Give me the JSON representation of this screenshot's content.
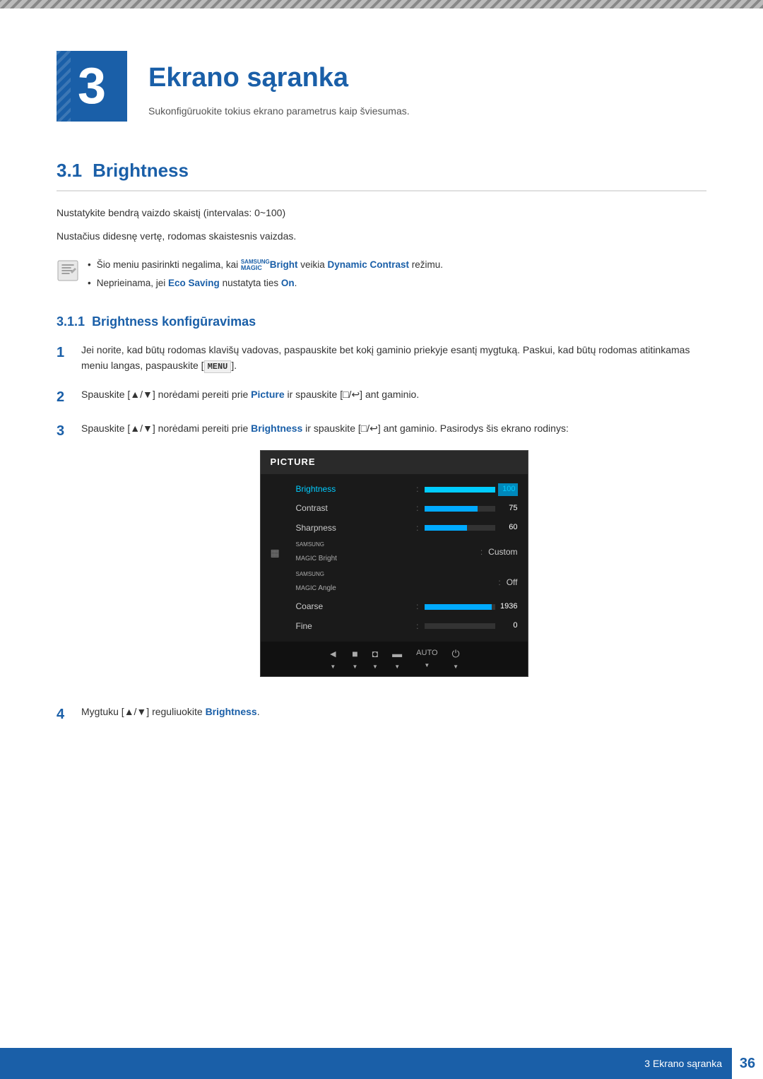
{
  "chapter": {
    "number": "3",
    "title": "Ekrano sąranka",
    "subtitle": "Sukonfigūruokite tokius ekrano parametrus kaip šviesumas.",
    "color": "#1a5fa8"
  },
  "section31": {
    "number": "3.1",
    "title": "Brightness",
    "body1": "Nustatykite bendrą vaizdo skaistį (intervalas: 0~100)",
    "body2": "Nustačius didesnę vertę, rodomas skaistesnis vaizdas.",
    "note1": "Šio meniu pasirinkti negalima, kai ",
    "note1_magic": "SAMSUNG",
    "note1_magic2": "MAGIC",
    "note1_bright": "Bright",
    "note1_mid": " veikia ",
    "note1_dynamic": "Dynamic Contrast",
    "note1_end": " režimu.",
    "note2_start": "Neprieinama, jei ",
    "note2_eco": "Eco Saving",
    "note2_end": " nustatyta ties ",
    "note2_on": "On",
    "note2_final": "."
  },
  "section311": {
    "number": "3.1.1",
    "title": "Brightness konfigūravimas",
    "step1": "Jei norite, kad būtų rodomas klavišų vadovas, paspauskite bet kokį gaminio priekyje esantį mygtuką. Paskui, kad būtų rodomas atitinkamas meniu langas, paspauskite [",
    "step1_key": "MENU",
    "step1_end": "].",
    "step2_start": "Spauskite [▲/▼] norėdami pereiti prie ",
    "step2_bold": "Picture",
    "step2_mid": " ir spauskite [□/↩] ant gaminio.",
    "step3_start": "Spauskite [▲/▼] norėdami pereiti prie ",
    "step3_bold": "Brightness",
    "step3_mid": " ir spauskite [□/↩] ant gaminio. Pasirodys šis ekrano rodinys:",
    "step4": "Mygtuku [▲/▼] reguliuokite ",
    "step4_bold": "Brightness",
    "step4_end": "."
  },
  "menu": {
    "header": "PICTURE",
    "rows": [
      {
        "label": "Brightness",
        "type": "bar",
        "fillPercent": 100,
        "value": "100",
        "active": true
      },
      {
        "label": "Contrast",
        "type": "bar",
        "fillPercent": 75,
        "value": "75",
        "active": false
      },
      {
        "label": "Sharpness",
        "type": "bar",
        "fillPercent": 60,
        "value": "60",
        "active": false
      },
      {
        "label": "SAMSUNG MAGIC Bright",
        "type": "text",
        "value": "Custom",
        "active": false
      },
      {
        "label": "SAMSUNG MAGIC Angle",
        "type": "text",
        "value": "Off",
        "active": false
      },
      {
        "label": "Coarse",
        "type": "bar",
        "fillPercent": 95,
        "value": "1936",
        "active": false
      },
      {
        "label": "Fine",
        "type": "bar",
        "fillPercent": 0,
        "value": "0",
        "active": false
      }
    ]
  },
  "footer": {
    "chapter_ref": "3 Ekrano sąranka",
    "page_number": "36"
  }
}
